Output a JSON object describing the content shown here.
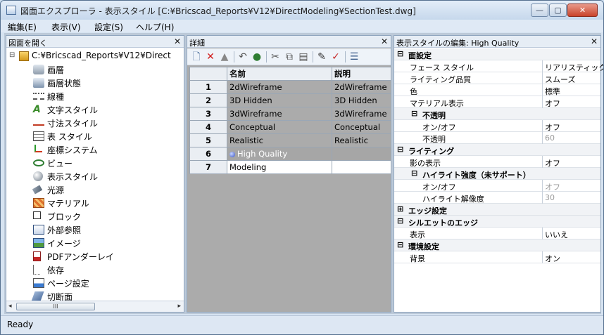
{
  "window": {
    "title": "図面エクスプローラ - 表示スタイル [C:¥Bricscad_Reports¥V12¥DirectModeling¥SectionTest.dwg]",
    "min": "—",
    "max": "▢",
    "close": "✕"
  },
  "menu": [
    "編集(E)",
    "表示(V)",
    "設定(S)",
    "ヘルプ(H)"
  ],
  "left_pane": {
    "title": "図面を開く",
    "close": "✕",
    "root": "C:¥Bricscad_Reports¥V12¥Direct",
    "items": [
      {
        "label": "画層",
        "icon": "layers-icon"
      },
      {
        "label": "画層状態",
        "icon": "layer-states-icon"
      },
      {
        "label": "線種",
        "icon": "linetype-icon"
      },
      {
        "label": "文字スタイル",
        "icon": "text-style-icon"
      },
      {
        "label": "寸法スタイル",
        "icon": "dim-style-icon"
      },
      {
        "label": "表 スタイル",
        "icon": "table-style-icon"
      },
      {
        "label": "座標システム",
        "icon": "ucs-icon"
      },
      {
        "label": "ビュー",
        "icon": "view-icon"
      },
      {
        "label": "表示スタイル",
        "icon": "visual-style-icon"
      },
      {
        "label": "光源",
        "icon": "light-icon"
      },
      {
        "label": "マテリアル",
        "icon": "material-icon"
      },
      {
        "label": "ブロック",
        "icon": "block-icon"
      },
      {
        "label": "外部参照",
        "icon": "xref-icon"
      },
      {
        "label": "イメージ",
        "icon": "image-icon"
      },
      {
        "label": "PDFアンダーレイ",
        "icon": "pdf-icon"
      },
      {
        "label": "依存",
        "icon": "dependency-icon"
      },
      {
        "label": "ページ設定",
        "icon": "page-setup-icon"
      },
      {
        "label": "切断面",
        "icon": "section-icon"
      }
    ],
    "scroll_thumb": "III",
    "scroll_left": "◂",
    "scroll_right": "▸"
  },
  "middle_pane": {
    "title": "詳細",
    "close": "✕",
    "columns": [
      "名前",
      "説明"
    ],
    "rows": [
      {
        "n": "1",
        "name": "2dWireframe",
        "desc": "2dWireframe"
      },
      {
        "n": "2",
        "name": "3D Hidden",
        "desc": "3D Hidden"
      },
      {
        "n": "3",
        "name": "3dWireframe",
        "desc": "3dWireframe"
      },
      {
        "n": "4",
        "name": "Conceptual",
        "desc": "Conceptual"
      },
      {
        "n": "5",
        "name": "Realistic",
        "desc": "Realistic"
      },
      {
        "n": "6",
        "name": "High Quality",
        "desc": ""
      },
      {
        "n": "7",
        "name": "Modeling",
        "desc": ""
      }
    ]
  },
  "right_pane": {
    "title": "表示スタイルの編集: High Quality",
    "close": "✕",
    "sections": {
      "face": {
        "toggle": "⊟",
        "label": "面設定"
      },
      "face_style": {
        "k": "フェース スタイル",
        "v": "リアリスティック"
      },
      "lighting_quality": {
        "k": "ライティング品質",
        "v": "スムーズ"
      },
      "color": {
        "k": "色",
        "v": "標準"
      },
      "material": {
        "k": "マテリアル表示",
        "v": "オフ"
      },
      "opacity": {
        "toggle": "⊟",
        "label": "不透明"
      },
      "opacity_onoff": {
        "k": "オン/オフ",
        "v": "オフ"
      },
      "opacity_val": {
        "k": "不透明",
        "v": "60"
      },
      "lighting": {
        "toggle": "⊟",
        "label": "ライティング"
      },
      "shadow": {
        "k": "影の表示",
        "v": "オフ"
      },
      "highlight": {
        "toggle": "⊟",
        "label": "ハイライト強度（未サポート）"
      },
      "hl_onoff": {
        "k": "オン/オフ",
        "v": "オフ"
      },
      "hl_res": {
        "k": "ハイライト解像度",
        "v": "30"
      },
      "edge": {
        "toggle": "⊞",
        "label": "エッジ設定"
      },
      "silhouette": {
        "toggle": "⊟",
        "label": "シルエットのエッジ"
      },
      "sil_show": {
        "k": "表示",
        "v": "いいえ"
      },
      "env": {
        "toggle": "⊟",
        "label": "環境設定"
      },
      "bg": {
        "k": "背景",
        "v": "オン"
      }
    }
  },
  "status": "Ready"
}
